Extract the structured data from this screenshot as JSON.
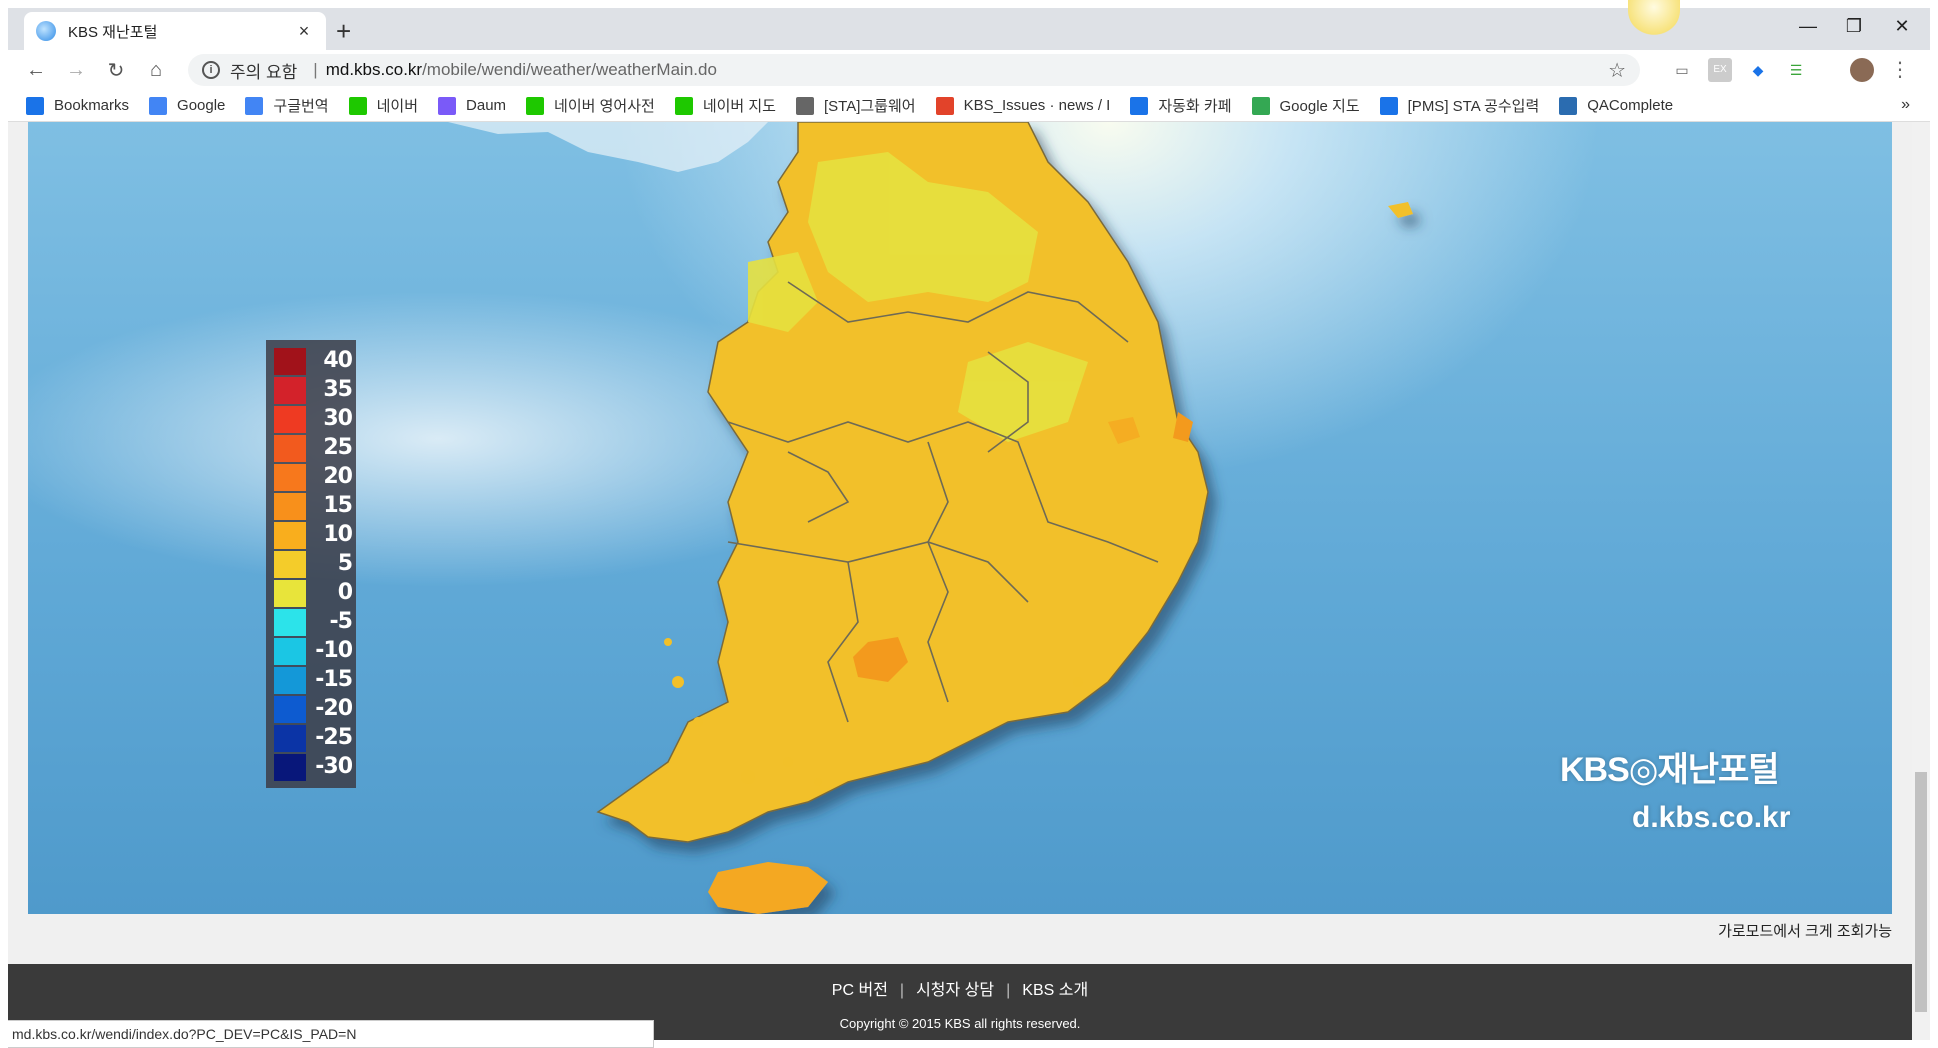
{
  "browser": {
    "tab_title": "KBS 재난포털",
    "tab_close": "×",
    "new_tab": "+",
    "window": {
      "minimize": "—",
      "maximize": "❐",
      "close": "✕"
    },
    "address": {
      "warning": "주의 요함",
      "separator": "|",
      "host": "md.kbs.co.kr",
      "path": "/mobile/wendi/weather/weatherMain.do"
    },
    "bookmarks": [
      {
        "label": "Bookmarks",
        "icon": "star-icon",
        "color": "#1a73e8"
      },
      {
        "label": "Google",
        "icon": "google-icon",
        "color": "#4285f4"
      },
      {
        "label": "구글번역",
        "icon": "translate-icon",
        "color": "#4285f4"
      },
      {
        "label": "네이버",
        "icon": "naver-icon",
        "color": "#1ec800"
      },
      {
        "label": "Daum",
        "icon": "daum-icon",
        "color": "#7a5af8"
      },
      {
        "label": "네이버 영어사전",
        "icon": "dict-icon",
        "color": "#1ec800"
      },
      {
        "label": "네이버 지도",
        "icon": "naver-icon",
        "color": "#1ec800"
      },
      {
        "label": "[STA]그룹웨어",
        "icon": "page-icon",
        "color": "#666666"
      },
      {
        "label": "KBS_Issues · news / I",
        "icon": "gitlab-icon",
        "color": "#e2432a"
      },
      {
        "label": "자동화 카페",
        "icon": "sta-icon",
        "color": "#1a73e8"
      },
      {
        "label": "Google 지도",
        "icon": "maps-icon",
        "color": "#34a853"
      },
      {
        "label": "[PMS] STA 공수입력",
        "icon": "pms-icon",
        "color": "#1a73e8"
      },
      {
        "label": "QAComplete",
        "icon": "qa-icon",
        "color": "#2b6cb0"
      }
    ],
    "bookmarks_more": "»",
    "status_url": "md.kbs.co.kr/wendi/index.do?PC_DEV=PC&IS_PAD=N"
  },
  "legend": {
    "labels": [
      "40",
      "35",
      "30",
      "25",
      "20",
      "15",
      "10",
      "5",
      "0",
      "-5",
      "-10",
      "-15",
      "-20",
      "-25",
      "-30"
    ],
    "colors": [
      "#a1121a",
      "#d3222a",
      "#ee3a22",
      "#f25a1e",
      "#f7781c",
      "#f8901b",
      "#f9ae1d",
      "#f4cc2a",
      "#e8e43a",
      "#2ce3ea",
      "#1bc6e4",
      "#1498d8",
      "#0d5bd0",
      "#0b34a6",
      "#08177a"
    ]
  },
  "brand": {
    "name": "KBS◎재난포털",
    "url": "d.kbs.co.kr"
  },
  "note": "가로모드에서 크게 조회가능",
  "footer": {
    "links": [
      "PC 버전",
      "시청자 상담",
      "KBS 소개"
    ],
    "divider": "|",
    "copyright": "Copyright © 2015 KBS all rights reserved."
  }
}
